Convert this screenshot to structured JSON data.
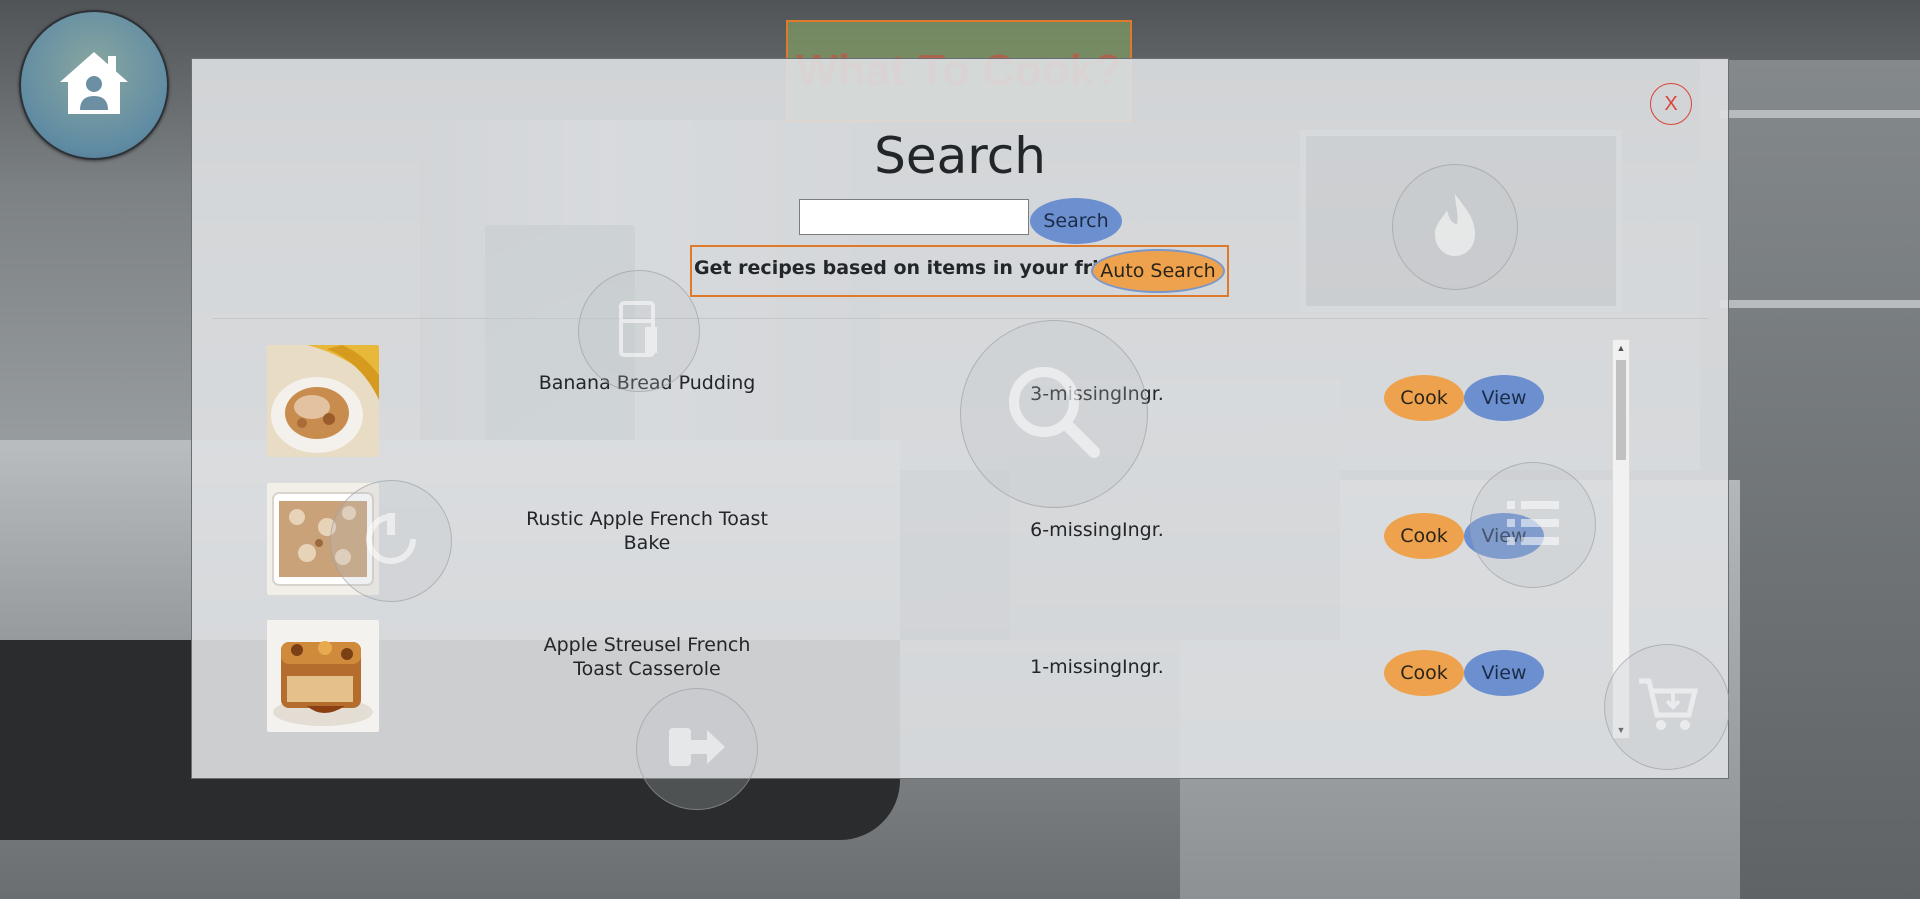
{
  "app": {
    "title_banner": "What To Cook?"
  },
  "modal": {
    "title": "Search",
    "close_label": "X",
    "search": {
      "placeholder": "",
      "value": "",
      "button_label": "Search"
    },
    "auto_search": {
      "label": "Get recipes based on items in your fridge",
      "button_label": "Auto Search"
    },
    "results": [
      {
        "name": "Banana Bread Pudding",
        "missing": "3-missingIngr.",
        "cook_label": "Cook",
        "view_label": "View",
        "thumb_icon": "banana-bread-pudding-photo"
      },
      {
        "name": "Rustic Apple French Toast Bake",
        "missing": "6-missingIngr.",
        "cook_label": "Cook",
        "view_label": "View",
        "thumb_icon": "apple-french-toast-photo"
      },
      {
        "name": "Apple Streusel French Toast Casserole",
        "missing": "1-missingIngr.",
        "cook_label": "Cook",
        "view_label": "View",
        "thumb_icon": "streusel-casserole-photo"
      }
    ]
  },
  "nav_icons": [
    "home-icon",
    "fridge-icon",
    "search-icon",
    "fire-icon",
    "list-icon",
    "plug-icon",
    "logout-icon",
    "cart-icon"
  ],
  "colors": {
    "orange": "#eea24d",
    "blue": "#6b8fcf",
    "accent_border": "#e07a2b",
    "close_red": "#d9453a"
  }
}
